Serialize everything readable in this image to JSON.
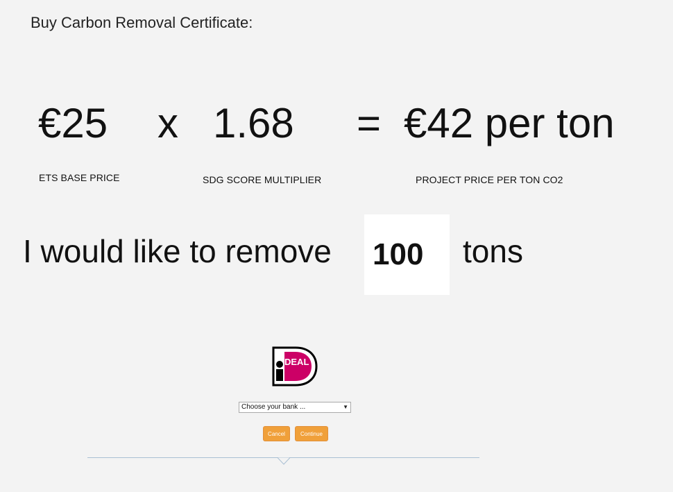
{
  "header": {
    "title": "Buy Carbon Removal Certificate:"
  },
  "equation": {
    "base_price": "€25",
    "times": "x",
    "multiplier": "1.68",
    "equals": "=",
    "result": "€42 per ton",
    "base_price_label": "ETS BASE PRICE",
    "multiplier_label": "SDG SCORE MULTIPLIER",
    "result_label": "PROJECT PRICE PER TON CO2"
  },
  "quantity": {
    "prefix": "I would like to remove",
    "value": "100",
    "suffix": "tons"
  },
  "payment": {
    "logo_text": "DEAL",
    "logo_letter": "i",
    "logo_colors": {
      "brand": "#cc0066",
      "outline": "#000000"
    },
    "bank_select_selected": "Choose your bank ...",
    "cancel_label": "Cancel",
    "continue_label": "Continue",
    "button_color": "#f0a03a"
  }
}
